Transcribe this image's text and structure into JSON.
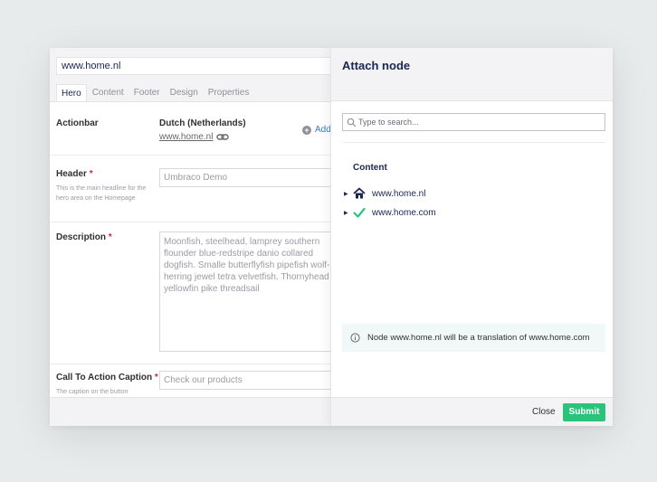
{
  "editor": {
    "node_name": "www.home.nl",
    "tabs": [
      "Hero",
      "Content",
      "Footer",
      "Design",
      "Properties"
    ],
    "actionbar": {
      "label": "Actionbar",
      "culture_name": "Dutch (Netherlands)",
      "culture_link": "www.home.nl",
      "add_label": "Add"
    },
    "header": {
      "label": "Header",
      "required_mark": "*",
      "description": "This is the main headline for the hero area on the Homepage",
      "value": "Umbraco Demo"
    },
    "description": {
      "label": "Description",
      "required_mark": "*",
      "value": "Moonfish, steelhead, lamprey southern flounder blue-redstripe danio collared dogfish. Smalle butterflyfish pipefish wolf-herring jewel tetra velvetfish. Thornyhead yellowfin pike threadsail"
    },
    "cta_caption": {
      "label": "Call To Action Caption",
      "required_mark": "*",
      "description": "The caption on the button",
      "value": "Check our products"
    }
  },
  "dialog": {
    "title": "Attach node",
    "search_placeholder": "Type to search...",
    "tree_root": "Content",
    "tree_items": [
      {
        "label": "www.home.nl",
        "icon": "home-icon"
      },
      {
        "label": "www.home.com",
        "icon": "check-icon"
      }
    ],
    "notice": "Node www.home.nl will be a translation of www.home.com",
    "close_label": "Close",
    "submit_label": "Submit"
  },
  "colors": {
    "accent_green": "#2bc37c",
    "link_blue": "#3879c7",
    "required_red": "#d42054",
    "notice_bg": "#f1f9f8"
  }
}
